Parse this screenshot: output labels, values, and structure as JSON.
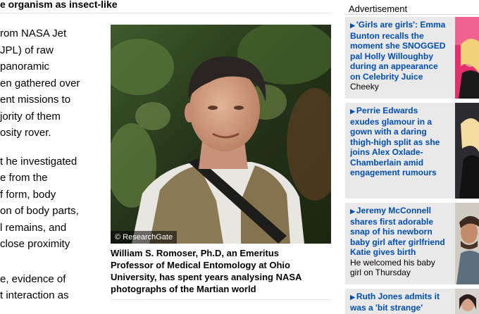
{
  "article": {
    "headline_fragment": "e organism as insect-like",
    "paragraph1": [
      "rom NASA Jet",
      "JPL) of raw",
      "panoramic",
      "en gathered over",
      "ent missions to",
      "jority of them",
      "osity rover."
    ],
    "paragraph2": [
      "t he investigated",
      "e from the",
      "f form, body",
      "on of body parts,",
      "l remains, and",
      "close proximity"
    ],
    "paragraph3": [
      "e, evidence of",
      "t interaction as"
    ]
  },
  "photo": {
    "copyright": "© ResearchGate",
    "caption_lines": [
      "William S. Romoser, Ph.D, an Emeritus",
      "Professor of Medical Entomology at Ohio",
      "University, has spent years analysing NASA",
      "photographs of the Martian world"
    ]
  },
  "sidebar": {
    "ad_label": "Advertisement",
    "stories": [
      {
        "title_lines": [
          "'Girls are girls': Emma",
          "Bunton recalls the",
          "moment she SNOGGED",
          "pal Holly Willoughby",
          "during an appearance",
          "on Celebrity Juice"
        ],
        "subtitle": "Cheeky",
        "thumb_icon": "celebrity-photo-thumbnail"
      },
      {
        "title_lines": [
          "Perrie Edwards",
          "exudes glamour in a",
          "gown with a daring",
          "thigh-high split as she",
          "joins Alex Oxlade-",
          "Chamberlain amid",
          "engagement rumours"
        ],
        "subtitle": "",
        "thumb_icon": "celebrity-photo-thumbnail"
      },
      {
        "title_lines": [
          "Jeremy McConnell",
          "shares first adorable",
          "snap of his newborn",
          "baby girl after girlfriend",
          "Katie gives birth"
        ],
        "subtitle_lines": [
          "He welcomed his baby",
          "girl on Thursday"
        ],
        "thumb_icon": "celebrity-photo-thumbnail"
      },
      {
        "title_lines": [
          "Ruth Jones admits it",
          "was a 'bit strange'"
        ],
        "subtitle": "",
        "thumb_icon": "celebrity-photo-thumbnail"
      }
    ]
  },
  "colors": {
    "link_blue": "#004db3",
    "sidebar_bg": "#e9e9e9",
    "rule": "#e3e3e3"
  }
}
